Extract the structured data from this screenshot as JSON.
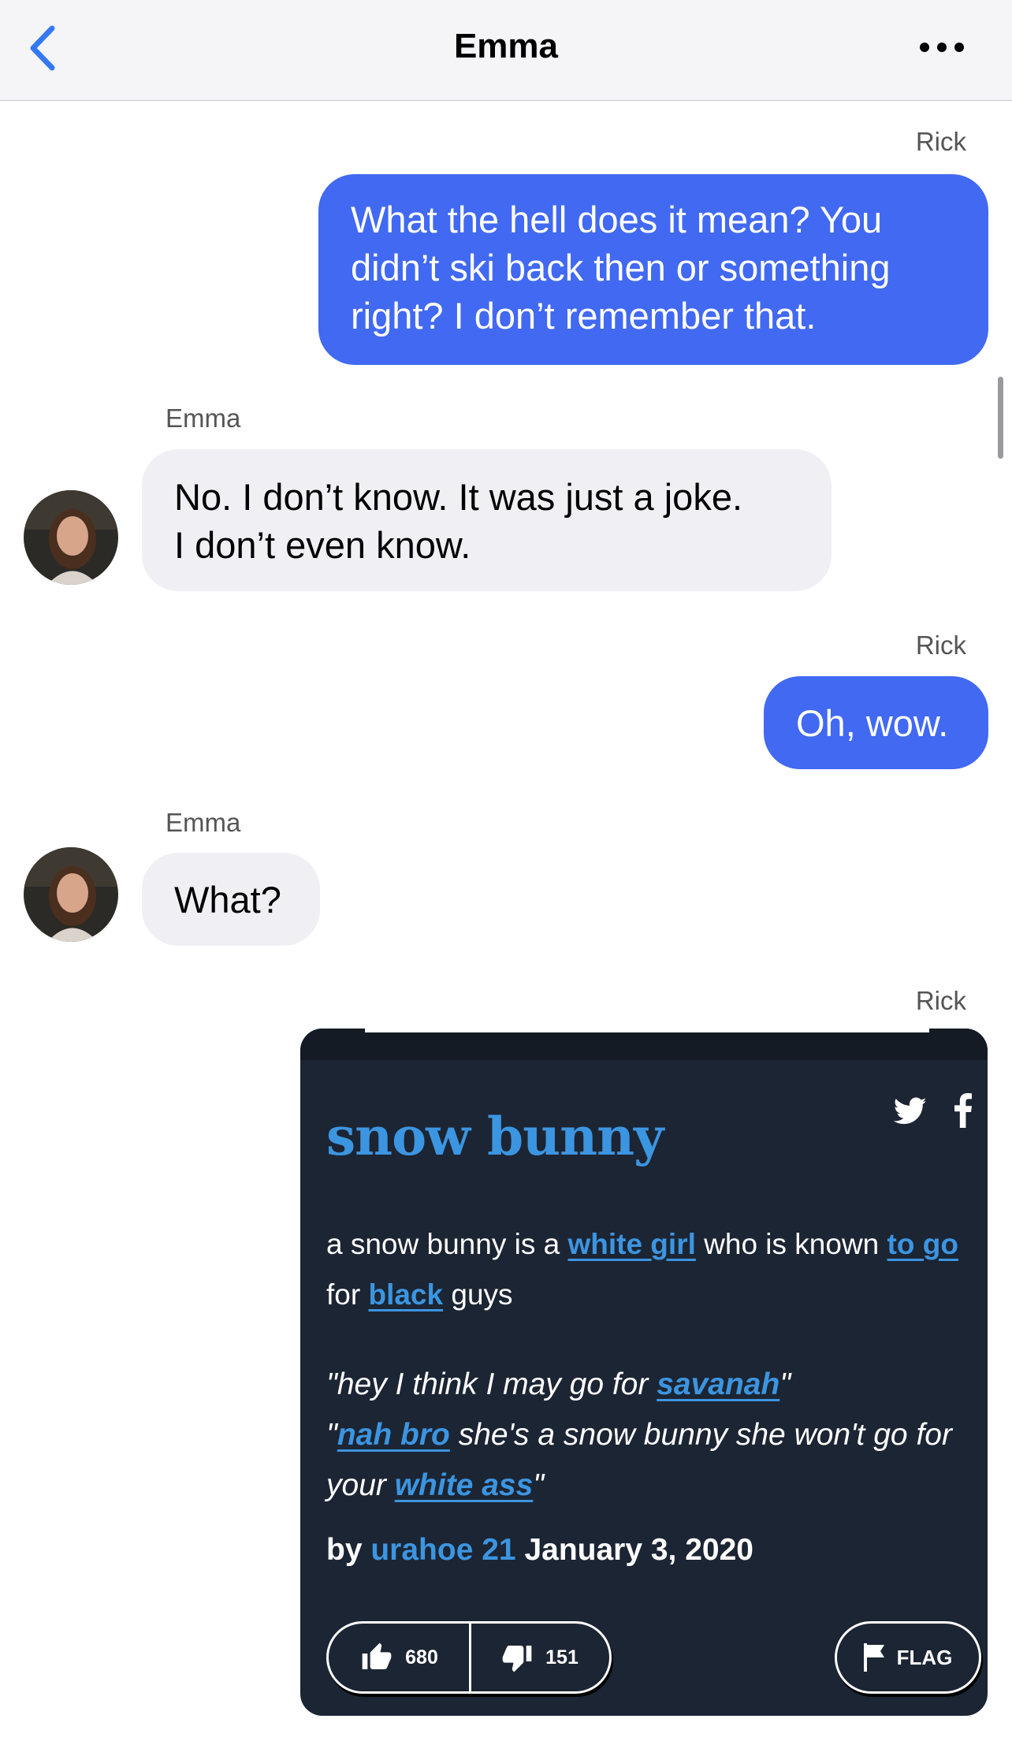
{
  "header": {
    "title": "Emma",
    "back_icon": "chevron-left-icon",
    "more_icon": "more-horizontal-icon",
    "accent_color": "#3478f6"
  },
  "messages": [
    {
      "sender": "Rick",
      "direction": "outgoing",
      "lines": [
        "What the hell does it mean? You",
        "didn’t ski back then or something",
        "right? I don’t remember that."
      ]
    },
    {
      "sender": "Emma",
      "direction": "incoming",
      "lines": [
        "No. I don’t know. It was just a joke.",
        "I don’t even know."
      ]
    },
    {
      "sender": "Rick",
      "direction": "outgoing",
      "lines": [
        "Oh, wow."
      ]
    },
    {
      "sender": "Emma",
      "direction": "incoming",
      "lines": [
        "What?"
      ]
    },
    {
      "sender": "Rick",
      "direction": "outgoing",
      "type": "image"
    }
  ],
  "colors": {
    "outgoing_bubble": "#4169f2",
    "incoming_bubble": "#f0eff4",
    "card_background": "#1c2533",
    "card_link": "#3c95e0"
  },
  "urban_card": {
    "word": "snow bunny",
    "definition": {
      "t1": "a snow bunny is a ",
      "l1": "white girl",
      "t2": " who is known ",
      "l2": "to go",
      "t3": " for ",
      "l3": "black",
      "t4": " guys"
    },
    "example": {
      "t1": "\"hey I think I may go for ",
      "l1": "savanah",
      "t2": "\"",
      "t3": "\"",
      "l2": "nah bro",
      "t4": " she's a snow bunny she won't go for your ",
      "l3": "white ass",
      "t5": "\""
    },
    "byline": {
      "by": "by ",
      "author": "urahoe 21",
      "date": " January 3, 2020"
    },
    "upvotes": "680",
    "downvotes": "151",
    "flag_label": "FLAG",
    "share_icons": [
      "twitter-icon",
      "facebook-icon"
    ]
  }
}
